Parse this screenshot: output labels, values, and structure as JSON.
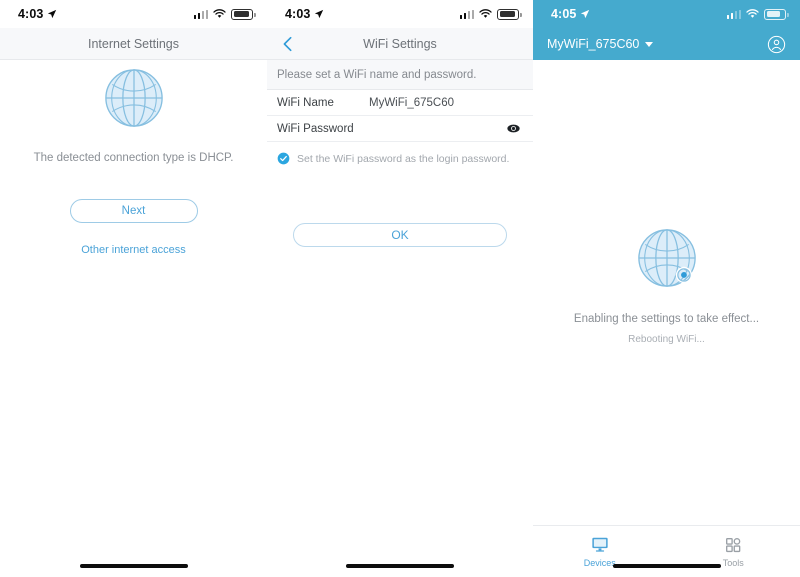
{
  "panels": [
    {
      "statusbar": {
        "time": "4:03",
        "location_icon": "location-arrow-icon",
        "signal_icon": "cellular-signal-icon",
        "wifi_icon": "wifi-icon",
        "battery_icon": "battery-icon"
      },
      "navbar": {
        "title": "Internet Settings"
      },
      "content": {
        "globe_icon": "globe-icon",
        "caption": "The detected connection type is DHCP.",
        "primary_button": "Next",
        "link": "Other internet access"
      }
    },
    {
      "statusbar": {
        "time": "4:03",
        "location_icon": "location-arrow-icon",
        "signal_icon": "cellular-signal-icon",
        "wifi_icon": "wifi-icon",
        "battery_icon": "battery-icon"
      },
      "navbar": {
        "title": "WiFi Settings",
        "back_icon": "chevron-left-icon"
      },
      "form": {
        "note": "Please set a WiFi name and password.",
        "rows": [
          {
            "label": "WiFi Name",
            "value": "MyWiFi_675C60",
            "placeholder": ""
          },
          {
            "label": "WiFi Password",
            "value": "",
            "placeholder": "",
            "trailing_icon": "eye-icon"
          }
        ],
        "checkbox": {
          "checked": true,
          "label": "Set the WiFi password as the login password.",
          "icon": "check-circle-icon"
        },
        "submit_button": "OK"
      }
    },
    {
      "statusbar": {
        "time": "4:05",
        "location_icon": "location-arrow-icon",
        "signal_icon": "cellular-signal-icon",
        "wifi_icon": "wifi-icon",
        "battery_icon": "battery-icon"
      },
      "navbar": {
        "router_name": "MyWiFi_675C60",
        "dropdown_icon": "caret-down-icon",
        "account_icon": "account-circle-icon"
      },
      "content": {
        "globe_icon": "globe-icon",
        "gear_icon": "gear-icon",
        "status_primary": "Enabling the settings to take effect...",
        "status_secondary": "Rebooting WiFi..."
      },
      "tabbar": [
        {
          "label": "Devices",
          "icon": "monitor-icon",
          "active": true
        },
        {
          "label": "Tools",
          "icon": "grid-apps-icon",
          "active": false
        }
      ]
    }
  ],
  "colors": {
    "accent_blue": "#4ba3d8",
    "header_blue": "#45aace",
    "globe_fill": "#dceef9",
    "globe_stroke": "#86bfe0",
    "muted_text": "#8a8f95",
    "nav_bg": "#f7f8fa"
  }
}
